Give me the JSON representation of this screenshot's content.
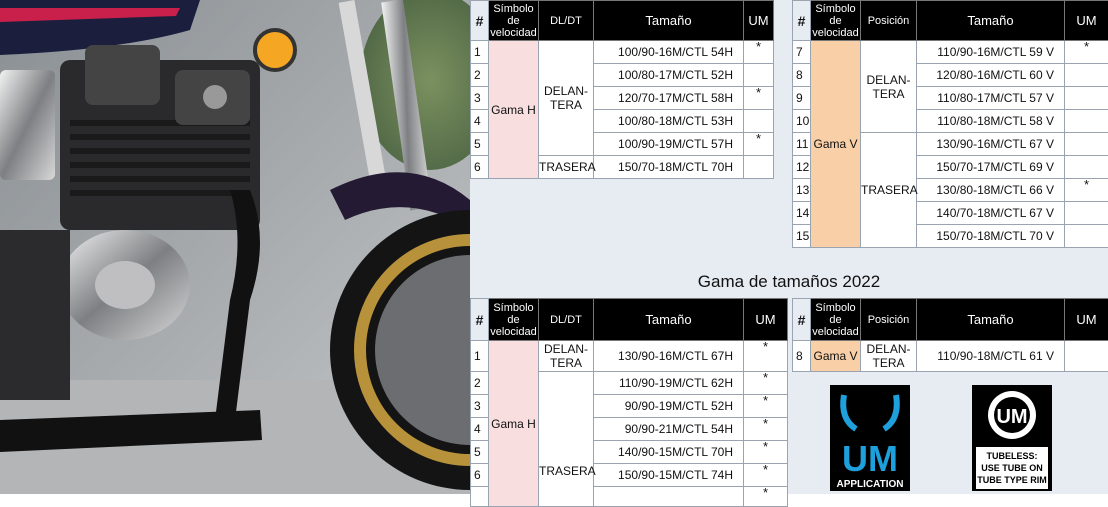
{
  "colors": {
    "header_bg": "#000000",
    "panel_bg": "#e7ecf3",
    "gama_h": "#f8dede",
    "gama_v": "#f9cfa8",
    "logo_blue": "#1ea0dc"
  },
  "t1_left": {
    "headers": [
      "#",
      "Símbolo de velocidad",
      "DL/DT",
      "Tamaño",
      "UM"
    ],
    "gama": "Gama H",
    "pos_front": "DELAN-TERA",
    "pos_rear": "TRASERA",
    "rows": [
      {
        "n": "1",
        "size": "100/90-16M/CTL  54H",
        "um": "*"
      },
      {
        "n": "2",
        "size": "100/80-17M/CTL  52H",
        "um": ""
      },
      {
        "n": "3",
        "size": "120/70-17M/CTL  58H",
        "um": "*"
      },
      {
        "n": "4",
        "size": "100/80-18M/CTL  53H",
        "um": ""
      },
      {
        "n": "5",
        "size": "100/90-19M/CTL  57H",
        "um": "*"
      },
      {
        "n": "6",
        "size": "150/70-18M/CTL  70H",
        "um": ""
      }
    ]
  },
  "t1_right": {
    "headers": [
      "#",
      "Símbolo de velocidad",
      "Posición",
      "Tamaño",
      "UM"
    ],
    "gama": "Gama V",
    "pos_front": "DELAN-TERA",
    "pos_rear": "TRASERA",
    "rows": [
      {
        "n": "7",
        "size": "110/90-16M/CTL  59 V",
        "um": "*"
      },
      {
        "n": "8",
        "size": "120/80-16M/CTL  60 V",
        "um": ""
      },
      {
        "n": "9",
        "size": "110/80-17M/CTL  57 V",
        "um": ""
      },
      {
        "n": "10",
        "size": "110/80-18M/CTL  58 V",
        "um": ""
      },
      {
        "n": "11",
        "size": "130/90-16M/CTL  67 V",
        "um": ""
      },
      {
        "n": "12",
        "size": "150/70-17M/CTL  69 V",
        "um": ""
      },
      {
        "n": "13",
        "size": "130/80-18M/CTL  66 V",
        "um": "*"
      },
      {
        "n": "14",
        "size": "140/70-18M/CTL  67 V",
        "um": ""
      },
      {
        "n": "15",
        "size": "150/70-18M/CTL  70 V",
        "um": ""
      }
    ]
  },
  "section_title": "Gama de tamaños 2022",
  "t2_left": {
    "headers": [
      "#",
      "Símbolo de velocidad",
      "DL/DT",
      "Tamaño",
      "UM"
    ],
    "gama": "Gama H",
    "pos_front": "DELAN-TERA",
    "pos_rear": "TRASERA",
    "rows": [
      {
        "n": "1",
        "size": "130/90-16M/CTL  67H",
        "um": "*"
      },
      {
        "n": "2",
        "size": "110/90-19M/CTL  62H",
        "um": "*"
      },
      {
        "n": "3",
        "size": "90/90-19M/CTL  52H",
        "um": "*"
      },
      {
        "n": "4",
        "size": "90/90-21M/CTL  54H",
        "um": "*"
      },
      {
        "n": "5",
        "size": "140/90-15M/CTL  70H",
        "um": "*"
      },
      {
        "n": "6",
        "size": "150/90-15M/CTL  74H",
        "um": "*"
      },
      {
        "n": "",
        "size": "",
        "um": "*"
      }
    ]
  },
  "t2_right": {
    "headers": [
      "#",
      "Símbolo de velocidad",
      "Posición",
      "Tamaño",
      "UM"
    ],
    "gama": "Gama V",
    "pos_front": "DELAN-TERA",
    "rows": [
      {
        "n": "8",
        "size": "110/90-18M/CTL  61 V",
        "um": ""
      }
    ]
  },
  "logo_um": {
    "mark": "UM",
    "caption": "APPLICATION"
  },
  "logo_tubeless": {
    "mark": "UM",
    "line1": "TUBELESS:",
    "line2": "USE TUBE ON",
    "line3": "TUBE TYPE RIM"
  }
}
